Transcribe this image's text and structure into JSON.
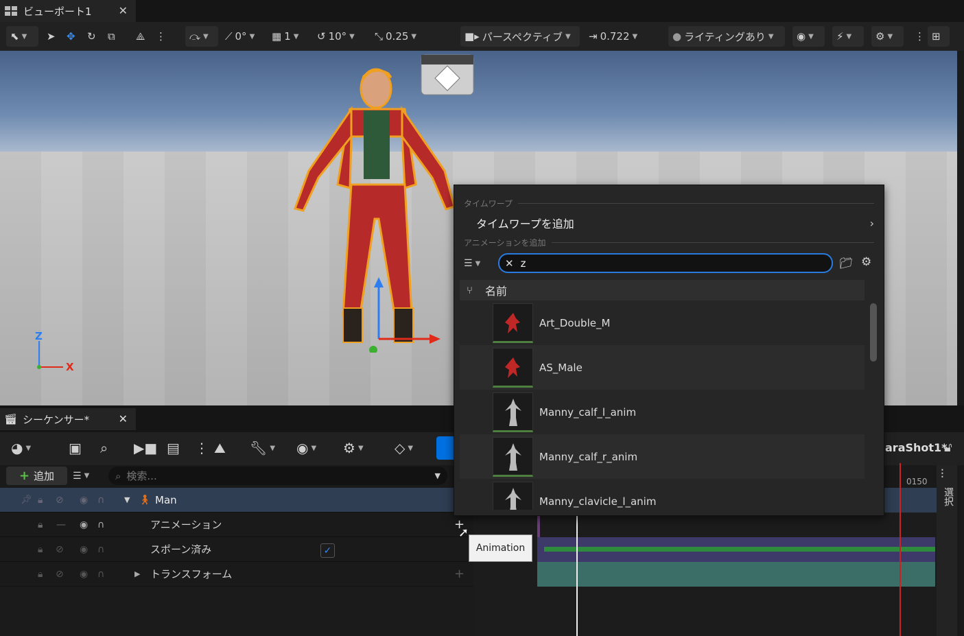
{
  "viewport": {
    "tab_title": "ビューポート1",
    "toolbar": {
      "snap_rot": "0°",
      "grid": "1",
      "angle": "10°",
      "scale": "0.25",
      "camera_mode": "パースペクティブ",
      "camera_speed": "0.722",
      "lighting": "ライティングあり"
    },
    "axes": {
      "z": "Z",
      "x": "X"
    }
  },
  "sequencer": {
    "tab_title": "シーケンサー*",
    "add_label": "追加",
    "search_placeholder": "検索...",
    "shot_name": "araShot1*",
    "frame_marker": "0150",
    "side_label": "選択",
    "tracks": [
      {
        "label": "Man"
      },
      {
        "label": "アニメーション"
      },
      {
        "label": "スポーン済み"
      },
      {
        "label": "トランスフォーム"
      }
    ]
  },
  "popup": {
    "section_timewarp": "タイムワープ",
    "add_timewarp": "タイムワープを追加",
    "section_add_anim": "アニメーションを追加",
    "search_value": "z",
    "column_name": "名前",
    "assets": [
      {
        "name": "Art_Double_M"
      },
      {
        "name": "AS_Male"
      },
      {
        "name": "Manny_calf_l_anim"
      },
      {
        "name": "Manny_calf_r_anim"
      },
      {
        "name": "Manny_clavicle_l_anim"
      }
    ]
  },
  "tooltip": "Animation",
  "colors": {
    "accent": "#0070e0",
    "selection_outline": "#f0a020",
    "track_green": "#2e8b3e",
    "track_purple": "#3d3a6a",
    "track_teal": "#3a6e66",
    "playhead_red": "#d02020"
  }
}
